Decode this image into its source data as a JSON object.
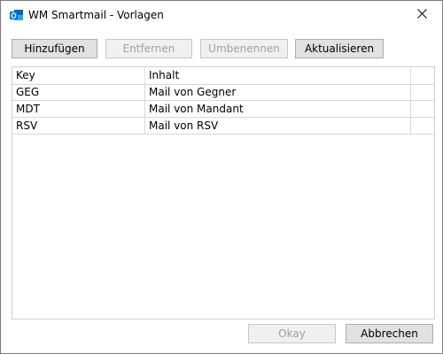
{
  "window": {
    "title": "WM Smartmail - Vorlagen",
    "icon": "outlook-icon",
    "close_label": "×"
  },
  "toolbar": {
    "add_label": "Hinzufügen",
    "remove_label": "Entfernen",
    "rename_label": "Umbenennen",
    "refresh_label": "Aktualisieren"
  },
  "grid": {
    "columns": [
      "Key",
      "Inhalt"
    ],
    "rows": [
      [
        "GEG",
        "Mail von Gegner"
      ],
      [
        "MDT",
        "Mail von Mandant"
      ],
      [
        "RSV",
        "Mail von RSV"
      ]
    ]
  },
  "footer": {
    "ok_label": "Okay",
    "cancel_label": "Abbrechen"
  },
  "colors": {
    "accent": "#0078d4",
    "button_bg": "#e1e1e1",
    "disabled_text": "#a0a0a0"
  }
}
